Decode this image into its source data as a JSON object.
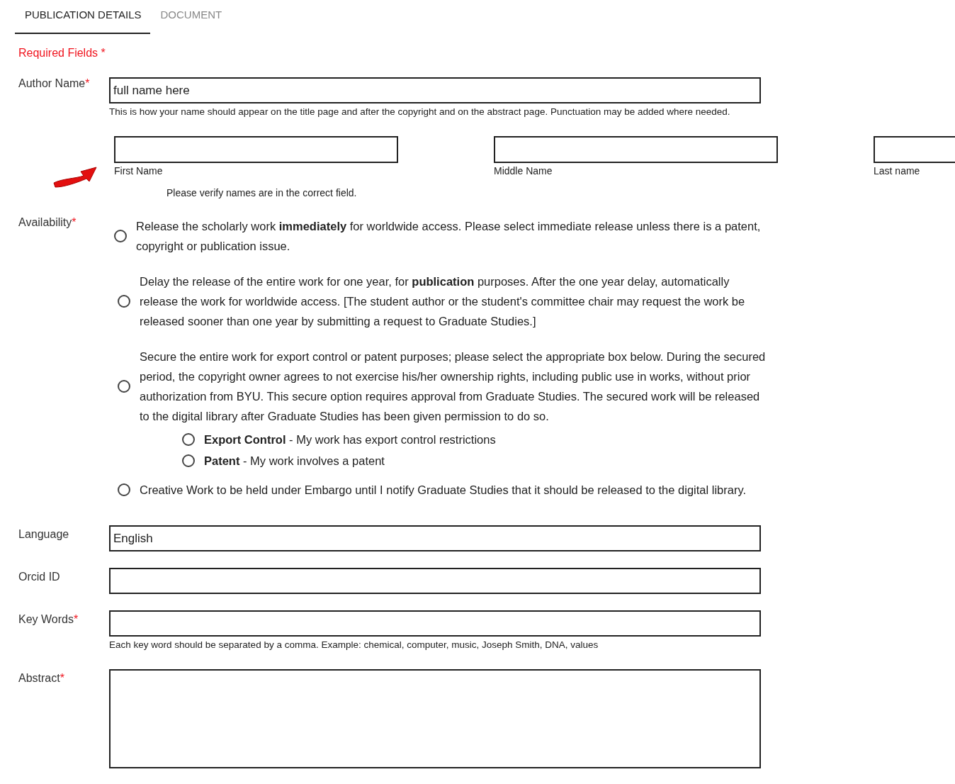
{
  "tabs": [
    {
      "label": "PUBLICATION DETAILS",
      "selected": true
    },
    {
      "label": "DOCUMENT",
      "selected": false
    }
  ],
  "required_note": {
    "text": "Required Fields",
    "mark": "*"
  },
  "author_name": {
    "label": "Author Name",
    "required_mark": "*",
    "value": "full name here",
    "help": "This is how your name should appear on the title page and after the copyright and on the abstract page. Punctuation may be added where needed."
  },
  "name_parts": [
    {
      "caption": "First Name"
    },
    {
      "caption": "Middle Name"
    },
    {
      "caption": "Last name"
    }
  ],
  "verify_note": "Please verify names are in the correct field.",
  "availability": {
    "label": "Availability",
    "required_mark": "*",
    "options": [
      {
        "text": "Release the scholarly work **immediately** for worldwide access. Please select immediate release unless there is a patent, copyright or publication issue.",
        "selected": false
      },
      {
        "text": "Delay the release of the entire work for one year, for **publication** purposes. After the one year delay, automatically release the work for worldwide access. [The student author or the student's committee chair may request the work be released sooner than one year by submitting a request to Graduate Studies.]",
        "selected": false
      },
      {
        "text": "Secure the entire work for export control or patent purposes; please select the appropriate box below. During the secured period, the copyright owner agrees to not exercise his/her ownership rights, including public use in works, without prior authorization from BYU. This secure option requires approval from Graduate Studies. The secured work will be released to the digital library after Graduate Studies has been given permission to do so.",
        "selected": false,
        "sub_options": [
          {
            "text": "**Export Control** - My work has export control restrictions",
            "selected": false
          },
          {
            "text": "**Patent** - My work involves a patent",
            "selected": false
          }
        ]
      },
      {
        "text": "Creative Work to be held under Embargo until I notify Graduate Studies that it should be released to the digital library.",
        "selected": false
      }
    ]
  },
  "fields": [
    {
      "kind": "input",
      "label": "Language",
      "value": "English"
    },
    {
      "kind": "input",
      "label": "Orcid ID"
    },
    {
      "kind": "input",
      "label": "Key Words",
      "required_mark": "*",
      "help": "Each key word should be separated by a comma. Example: chemical, computer, music, Joseph Smith, DNA, values"
    },
    {
      "kind": "textarea",
      "label": "Abstract",
      "required_mark": "*"
    }
  ]
}
